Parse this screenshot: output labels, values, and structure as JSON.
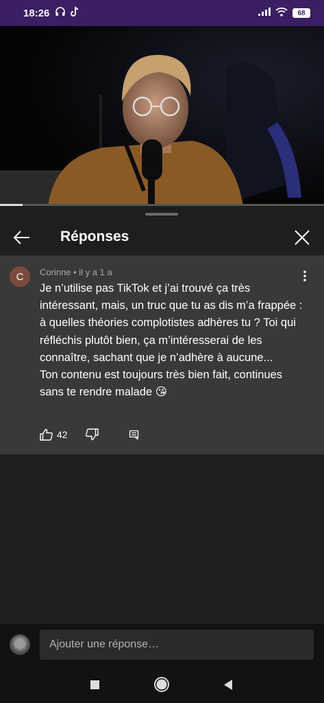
{
  "status_bar": {
    "time": "18:26",
    "left_icons": [
      "headphones-icon",
      "tiktok-icon"
    ],
    "right_icons": [
      "signal-icon",
      "wifi-icon",
      "battery-icon"
    ],
    "battery_level": "68"
  },
  "video": {
    "progress_fraction": 0.07
  },
  "sheet": {
    "title": "Réponses"
  },
  "comment": {
    "avatar_initial": "C",
    "author": "Corinne",
    "time_ago": "il y a 1 a",
    "meta": "Corinne • il y a 1 a",
    "paragraph_1": "Je n’utilise pas TikTok et j’ai trouvé ça très intéressant,  mais, un truc que tu as dis m’a frappée : à quelles théories complotistes adhères tu ? Toi qui réfléchis plutôt bien,  ça m’intéresserai de les connaître, sachant que je n’adhère à aucune...",
    "paragraph_2": "Ton contenu est toujours très bien fait, continues sans te rendre malade 😘",
    "like_count": "42"
  },
  "compose": {
    "placeholder": "Ajouter une réponse…"
  },
  "colors": {
    "status_bar": "#3b1f62",
    "sheet_background": "#1e1e1e",
    "comment_background": "#393939",
    "avatar": "#7a4a3d"
  }
}
